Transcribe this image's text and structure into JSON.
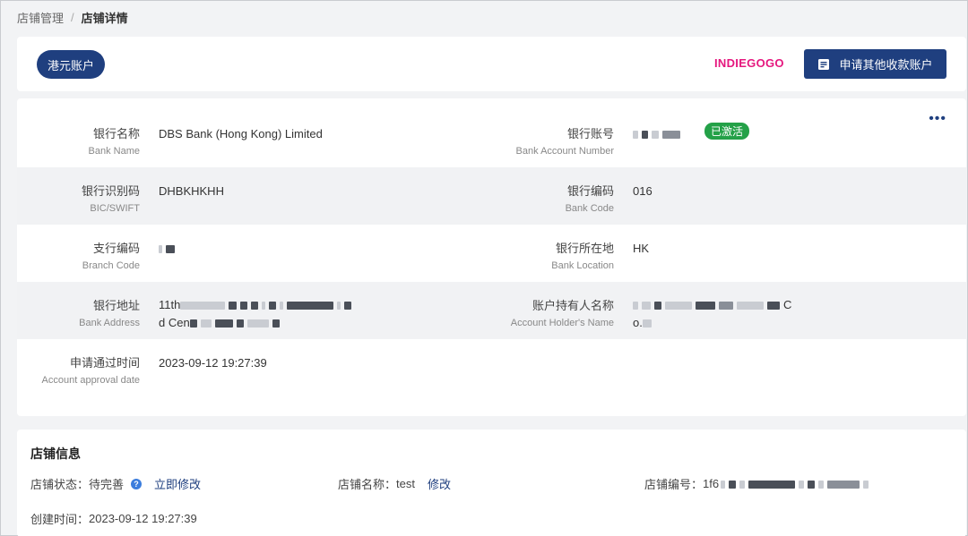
{
  "breadcrumb": {
    "parent": "店铺管理",
    "separator": "/",
    "current": "店铺详情"
  },
  "top": {
    "tab_label": "港元账户",
    "brand_logo": "INDIEGOGO",
    "apply_button": "申请其他收款账户",
    "apply_icon": "form-icon"
  },
  "account": {
    "bank_name": {
      "cn": "银行名称",
      "en": "Bank Name",
      "value": "DBS Bank (Hong Kong) Limited"
    },
    "account_number": {
      "cn": "银行账号",
      "en": "Bank Account Number",
      "status": "已激活"
    },
    "bic": {
      "cn": "银行识别码",
      "en": "BIC/SWIFT",
      "value": "DHBKHKHH"
    },
    "bank_code": {
      "cn": "银行编码",
      "en": "Bank Code",
      "value": "016"
    },
    "branch_code": {
      "cn": "支行编码",
      "en": "Branch Code"
    },
    "bank_location": {
      "cn": "银行所在地",
      "en": "Bank Location",
      "value": "HK"
    },
    "bank_address": {
      "cn": "银行地址",
      "en": "Bank Address",
      "line1_prefix": "11th",
      "line2_prefix": "d Cen"
    },
    "holder_name": {
      "cn": "账户持有人名称",
      "en": "Account Holder's Name",
      "line1_suffix": "C",
      "line2_prefix": "o."
    },
    "approval_date": {
      "cn": "申请通过时间",
      "en": "Account approval date",
      "value": "2023-09-12 19:27:39"
    }
  },
  "store": {
    "title": "店铺信息",
    "status_label": "店铺状态：",
    "status_value": "待完善",
    "modify_now": "立即修改",
    "name_label": "店铺名称：",
    "name_value": "test",
    "modify": "修改",
    "id_label": "店铺编号：",
    "id_prefix": "1f6",
    "created_label": "创建时间：",
    "created_value": "2023-09-12 19:27:39"
  },
  "colors": {
    "primary": "#1f3f7f",
    "brand": "#e5177e",
    "success": "#24a148"
  }
}
